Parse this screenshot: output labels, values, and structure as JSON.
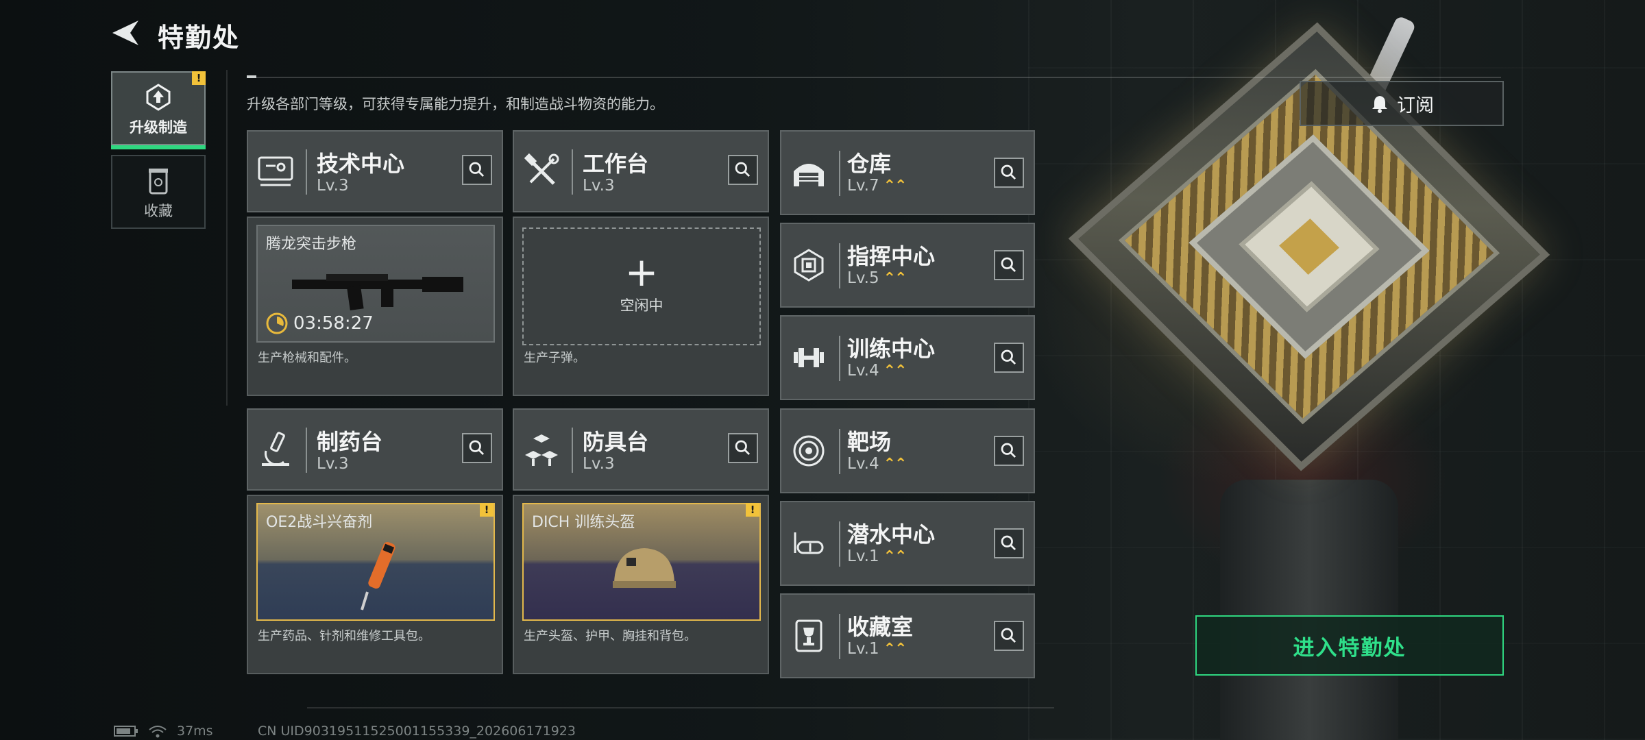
{
  "header": {
    "title": "特勤处",
    "description": "升级各部门等级，可获得专属能力提升，和制造战斗物资的能力。"
  },
  "nav": {
    "items": [
      {
        "label": "升级制造",
        "badge": "!",
        "active": true
      },
      {
        "label": "收藏",
        "active": false
      }
    ]
  },
  "stations": {
    "tech": {
      "name": "技术中心",
      "level": "Lv.3",
      "product": "腾龙突击步枪",
      "timer": "03:58:27",
      "description": "生产枪械和配件。"
    },
    "workbench": {
      "name": "工作台",
      "level": "Lv.3",
      "idle_label": "空闲中",
      "idle_plus": "+",
      "description": "生产子弹。"
    },
    "pharmacy": {
      "name": "制药台",
      "level": "Lv.3",
      "product": "OE2战斗兴奋剂",
      "badge": "!",
      "description": "生产药品、针剂和维修工具包。"
    },
    "armor": {
      "name": "防具台",
      "level": "Lv.3",
      "product": "DICH 训练头盔",
      "badge": "!",
      "description": "生产头盔、护甲、胸挂和背包。"
    }
  },
  "departments": [
    {
      "name": "仓库",
      "level": "Lv.7",
      "icon": "warehouse-icon"
    },
    {
      "name": "指挥中心",
      "level": "Lv.5",
      "icon": "chip-icon"
    },
    {
      "name": "训练中心",
      "level": "Lv.4",
      "icon": "dumbbell-icon"
    },
    {
      "name": "靶场",
      "level": "Lv.4",
      "icon": "target-icon"
    },
    {
      "name": "潜水中心",
      "level": "Lv.1",
      "icon": "diving-mask-icon"
    },
    {
      "name": "收藏室",
      "level": "Lv.1",
      "icon": "trophy-icon"
    }
  ],
  "level_up_marker": "⌃⌃",
  "subscribe_label": "订阅",
  "enter_label": "进入特勤处",
  "status": {
    "ping": "37ms",
    "uid": "CN UID9031951152500115533​9_202606171923"
  },
  "colors": {
    "accent_green": "#2fd780",
    "badge_yellow": "#f2c23a"
  }
}
